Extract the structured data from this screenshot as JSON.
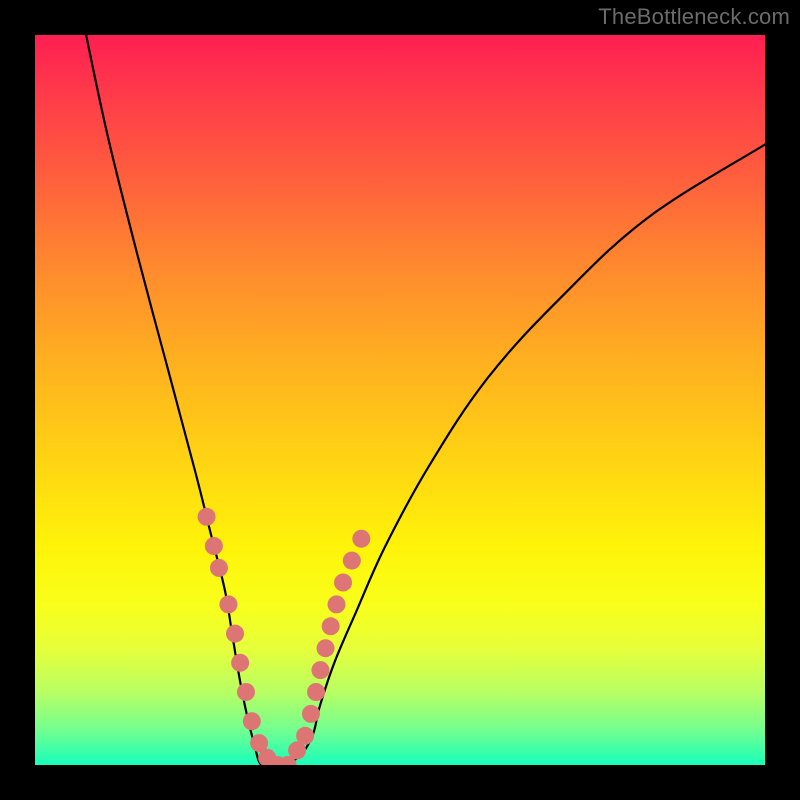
{
  "watermark": "TheBottleneck.com",
  "colors": {
    "background_black": "#000000",
    "gradient_top": "#ff1f52",
    "gradient_bottom": "#18ffba",
    "curve": "#000000",
    "dots": "#dd7575"
  },
  "chart_data": {
    "type": "line",
    "title": "",
    "xlabel": "",
    "ylabel": "",
    "xlim": [
      0,
      100
    ],
    "ylim": [
      0,
      100
    ],
    "series": [
      {
        "name": "bottleneck-curve",
        "x": [
          7,
          10,
          14,
          18,
          22,
          24,
          26,
          27,
          28,
          29,
          30,
          31,
          33,
          36,
          38,
          39,
          41,
          44,
          48,
          54,
          62,
          72,
          84,
          100
        ],
        "y": [
          100,
          86,
          70,
          55,
          40,
          32,
          24,
          18,
          12,
          7,
          3,
          0,
          0,
          1,
          4,
          8,
          14,
          21,
          30,
          41,
          53,
          64,
          75,
          85
        ]
      }
    ],
    "highlighted_points": {
      "name": "salmon-dots",
      "x": [
        23.5,
        24.5,
        25.2,
        26.5,
        27.4,
        28.1,
        28.9,
        29.7,
        30.7,
        31.8,
        33.2,
        34.6,
        35.9,
        37.0,
        37.8,
        38.5,
        39.1,
        39.8,
        40.5,
        41.3,
        42.2,
        43.4,
        44.7
      ],
      "y": [
        34,
        30,
        27,
        22,
        18,
        14,
        10,
        6,
        3,
        1,
        0,
        0,
        2,
        4,
        7,
        10,
        13,
        16,
        19,
        22,
        25,
        28,
        31
      ]
    }
  }
}
